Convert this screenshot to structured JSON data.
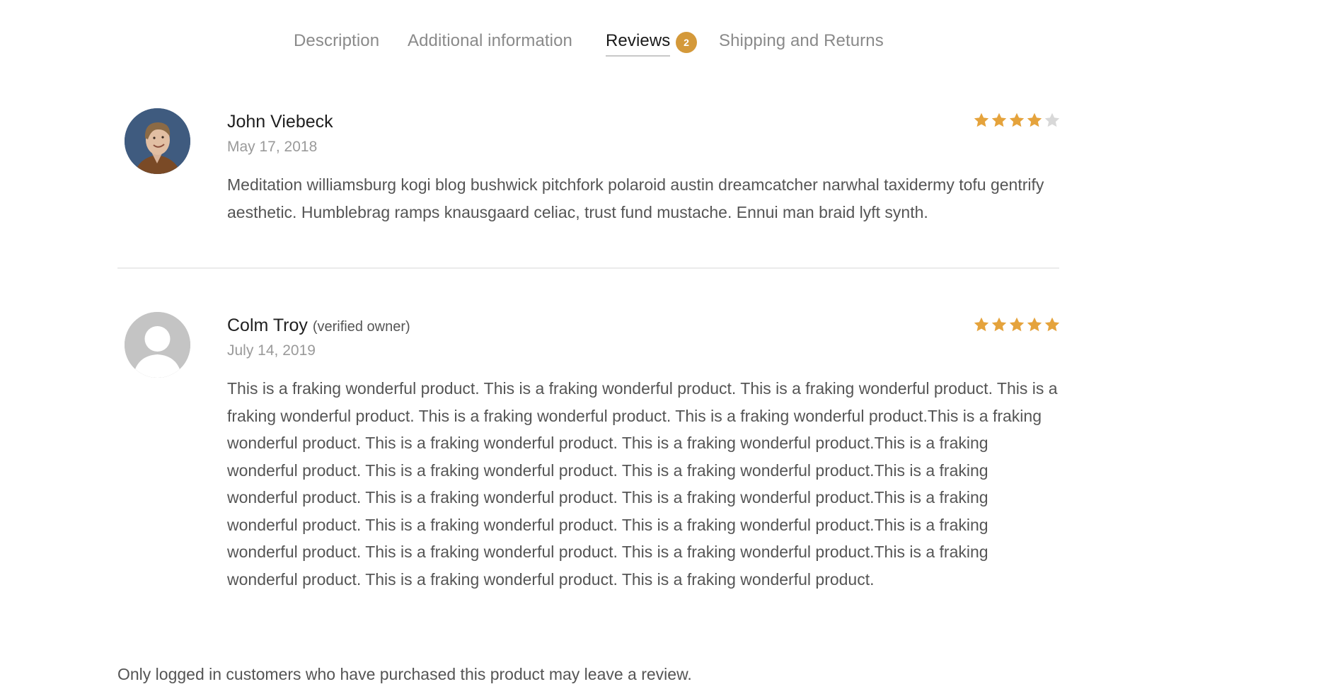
{
  "tabs": [
    {
      "label": "Description",
      "active": false
    },
    {
      "label": "Additional information",
      "active": false
    },
    {
      "label": "Reviews",
      "active": true,
      "badge": "2"
    },
    {
      "label": "Shipping and Returns",
      "active": false
    }
  ],
  "colors": {
    "accent": "#d4993a",
    "star_filled": "#e5a33c",
    "star_empty": "#d8d8d8",
    "divider": "#ebebeb"
  },
  "reviews": [
    {
      "author": "John Viebeck",
      "verified_label": "",
      "date": "May 17, 2018",
      "rating": 4,
      "max_rating": 5,
      "avatar": "user-photo",
      "text": "Meditation williamsburg kogi blog bushwick pitchfork polaroid austin dreamcatcher narwhal taxidermy tofu gentrify aesthetic. Humblebrag ramps knausgaard celiac, trust fund mustache. Ennui man braid lyft synth."
    },
    {
      "author": "Colm Troy",
      "verified_label": "(verified owner)",
      "date": "July 14, 2019",
      "rating": 5,
      "max_rating": 5,
      "avatar": "default-user-icon",
      "text": "This is a fraking wonderful product. This is a fraking wonderful product. This is a fraking wonderful product. This is a fraking wonderful product. This is a fraking wonderful product. This is a fraking wonderful product.This is a fraking wonderful product. This is a fraking wonderful product. This is a fraking wonderful product.This is a fraking wonderful product. This is a fraking wonderful product. This is a fraking wonderful product.This is a fraking wonderful product. This is a fraking wonderful product. This is a fraking wonderful product.This is a fraking wonderful product. This is a fraking wonderful product. This is a fraking wonderful product.This is a fraking wonderful product. This is a fraking wonderful product. This is a fraking wonderful product.This is a fraking wonderful product. This is a fraking wonderful product. This is a fraking wonderful product."
    }
  ],
  "footer_note": "Only logged in customers who have purchased this product may leave a review."
}
